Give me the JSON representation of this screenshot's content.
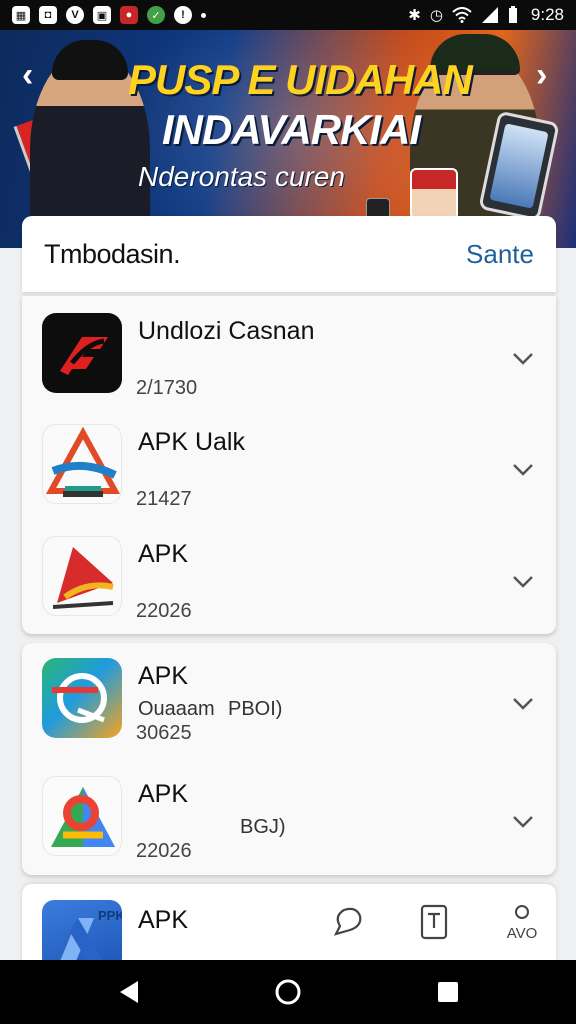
{
  "status_bar": {
    "time": "9:28",
    "left_icons": [
      "grid-app-icon",
      "bag-app-icon",
      "vpn-app-icon",
      "gallery-app-icon",
      "red-app-icon",
      "green-app-icon",
      "alert-icon",
      "dot-icon"
    ],
    "right_icons": [
      "bluetooth-icon",
      "alarm-icon",
      "wifi-icon",
      "signal-icon",
      "battery-icon"
    ]
  },
  "banner": {
    "title": "PUSP E UIDAHAN",
    "subtitle": "INDAVARKIAI",
    "caption": "Nderontas curen",
    "prev_arrow": "‹",
    "next_arrow": "›"
  },
  "header": {
    "title": "Tmbodasin.",
    "action": "Sante"
  },
  "list_group_1": [
    {
      "title": "Undlozi Casnan",
      "number": "2/1730",
      "icon": "red-swoosh-app-icon"
    },
    {
      "title": "APK Ualk",
      "number": "21427",
      "icon": "blue-triangle-app-icon"
    },
    {
      "title": "APK",
      "number": "22026",
      "icon": "red-flag-app-icon"
    }
  ],
  "list_group_2": [
    {
      "title": "APK",
      "extra": "Ouaaam",
      "extra2": "PBOI)",
      "number": "30625",
      "icon": "gradient-app-icon"
    },
    {
      "title": "APK",
      "extra": "",
      "extra2": "BGJ)",
      "number": "22026",
      "icon": "maps-app-icon"
    }
  ],
  "bottom": {
    "title": "APK",
    "icon_label": "PPK",
    "icon_name": "drive-app-icon",
    "tabs": [
      "chat-tab-icon",
      "book-tab-icon",
      "profile-tab-icon"
    ],
    "profile_label": "AVO"
  },
  "colors": {
    "accent_blue": "#1f5f9c",
    "banner_yellow": "#ffd21f"
  }
}
